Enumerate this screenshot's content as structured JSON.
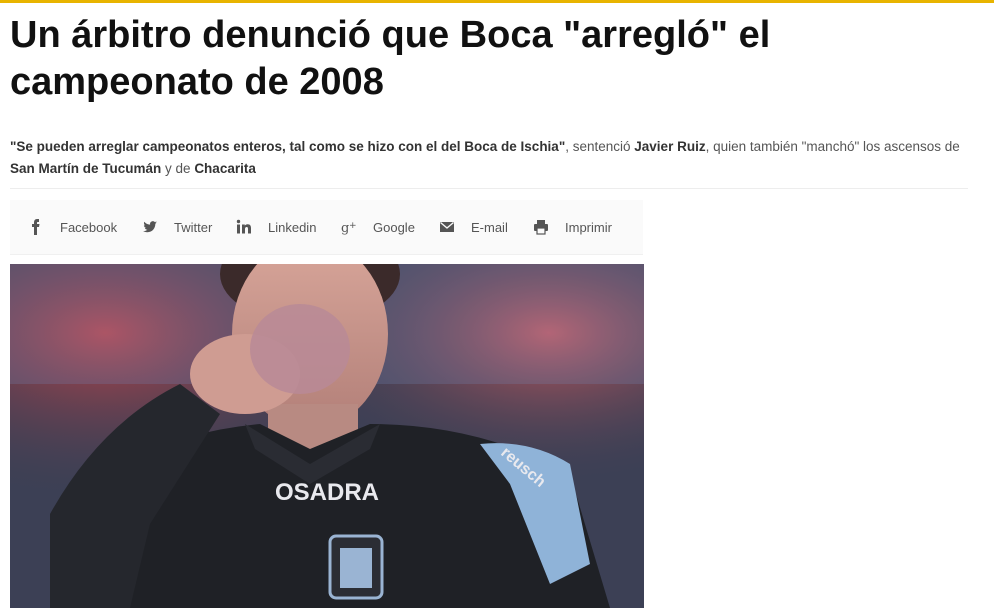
{
  "article": {
    "title_line1": "Un árbitro denunció que Boca \"arregló\" el",
    "title_line2": "campeonato de 2008",
    "summary": {
      "quote": "\"Se pueden arreglar campeonatos enteros, tal como se hizo con el del Boca de Ischia\"",
      "t1": ", sentenció ",
      "name": "Javier Ruiz",
      "t2": ", quien también \"manchó\" los ascensos de ",
      "club1": "San Martín de Tucumán",
      "t3": " y de ",
      "club2": "Chacarita"
    },
    "photo": {
      "shirt_text": "OSADRA",
      "sleeve_text": "reusch"
    }
  },
  "share": {
    "items": [
      {
        "label": "Facebook",
        "icon": "facebook-icon"
      },
      {
        "label": "Twitter",
        "icon": "twitter-icon"
      },
      {
        "label": "Linkedin",
        "icon": "linkedin-icon"
      },
      {
        "label": "Google",
        "icon": "google-plus-icon"
      },
      {
        "label": "E-mail",
        "icon": "email-icon"
      },
      {
        "label": "Imprimir",
        "icon": "print-icon"
      }
    ]
  },
  "colors": {
    "accent": "#e8b400",
    "title": "#111111",
    "text": "#555555"
  }
}
